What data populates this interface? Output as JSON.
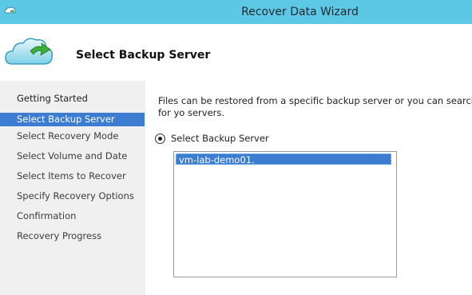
{
  "window": {
    "title": "Recover Data Wizard"
  },
  "header": {
    "title": "Select Backup Server"
  },
  "nav": {
    "items": [
      "Getting Started",
      "Select Backup Server",
      "Select Recovery Mode",
      "Select Volume and Date",
      "Select Items to Recover",
      "Specify Recovery Options",
      "Confirmation",
      "Recovery Progress"
    ],
    "selected": "Select Backup Server"
  },
  "content": {
    "description": "Files can be restored from a specific backup server or you can search for yo servers.",
    "radio_label": "Select Backup Server",
    "server_list": [
      "vm-lab-demo01."
    ]
  },
  "colors": {
    "titlebar": "#5cc8e6",
    "selection": "#3c7dd2",
    "nav_bg": "#f0f0f0"
  }
}
